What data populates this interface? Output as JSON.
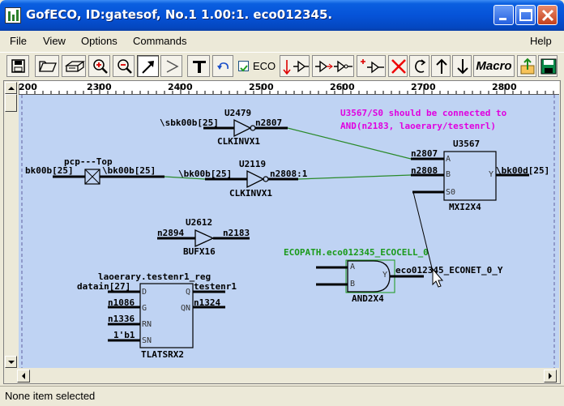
{
  "window": {
    "title": "GofECO, ID:gatesof, No.1 1.00:1. eco012345."
  },
  "menu": {
    "file": "File",
    "view": "View",
    "options": "Options",
    "commands": "Commands",
    "help": "Help"
  },
  "toolbar": {
    "eco_label": "ECO",
    "eco_checked": true,
    "macro_label": "Macro",
    "icons": [
      "save-icon",
      "open-icon",
      "print-icon",
      "zoom-in-icon",
      "zoom-out-icon",
      "select-arrow-icon",
      "buffer-icon",
      "text-icon",
      "undo-icon",
      "insert-buffer-icon",
      "insert-inverter-icon",
      "insert-gate-icon",
      "delete-icon",
      "rotate-icon",
      "up-arrow-icon",
      "down-arrow-icon",
      "macro-icon",
      "upload-icon",
      "save-disk-icon"
    ]
  },
  "ruler": {
    "labels": [
      "200",
      "2300",
      "2400",
      "2500",
      "2600",
      "2700",
      "2800"
    ]
  },
  "schematic": {
    "note_line1": "U3567/S0 should be connected to",
    "note_line2": "AND(n2183, laoerary/testenrl)",
    "u2479_name": "U2479",
    "u2479_type": "CLKINVX1",
    "u2479_in": "\\sbk00b[25]",
    "u2479_out": "n2807",
    "u2119_name": "U2119",
    "u2119_type": "CLKINVX1",
    "u2119_in": "\\bk00b[25]",
    "u2119_out": "n2808:1",
    "port_name": "pcp---Top",
    "port_left": "bk00b[25]",
    "port_right": "\\bk00b[25]",
    "u3567_name": "U3567",
    "u3567_type": "MXI2X4",
    "u3567_net_a": "n2807",
    "u3567_net_b": "n2808",
    "u3567_out": "\\bk00d[25]",
    "u3567_pin_a": "A",
    "u3567_pin_b": "B",
    "u3567_pin_s0": "S0",
    "u3567_pin_y": "Y",
    "u2612_name": "U2612",
    "u2612_type": "BUFX16",
    "u2612_in": "n2894",
    "u2612_out": "n2183",
    "eco_path": "ECOPATH.eco012345_ECOCELL_0",
    "eco_and_type": "AND2X4",
    "eco_and_pin_a": "A",
    "eco_and_pin_b": "B",
    "eco_and_pin_y": "Y",
    "eco_net": "eco012345_ECONET_0_Y",
    "reg_name": "laoerary.testenr1_reg",
    "reg_type": "TLATSRX2",
    "reg_d_net": "datain[27]",
    "reg_q_net": "testenr1",
    "reg_g_net": "n1086",
    "reg_qn_net": "n1324",
    "reg_rn_net": "n1336",
    "reg_sn_net": "1'b1",
    "reg_pin_d": "D",
    "reg_pin_q": "Q",
    "reg_pin_g": "G",
    "reg_pin_qn": "QN",
    "reg_pin_rn": "RN",
    "reg_pin_sn": "SN"
  },
  "colors": {
    "canvas_bg": "#bfd3f3",
    "note": "#e000e0",
    "eco_path": "#1a9a1a",
    "wire": "#000000",
    "green_wire": "#2a8a2a"
  },
  "status": {
    "text": "None item selected"
  }
}
